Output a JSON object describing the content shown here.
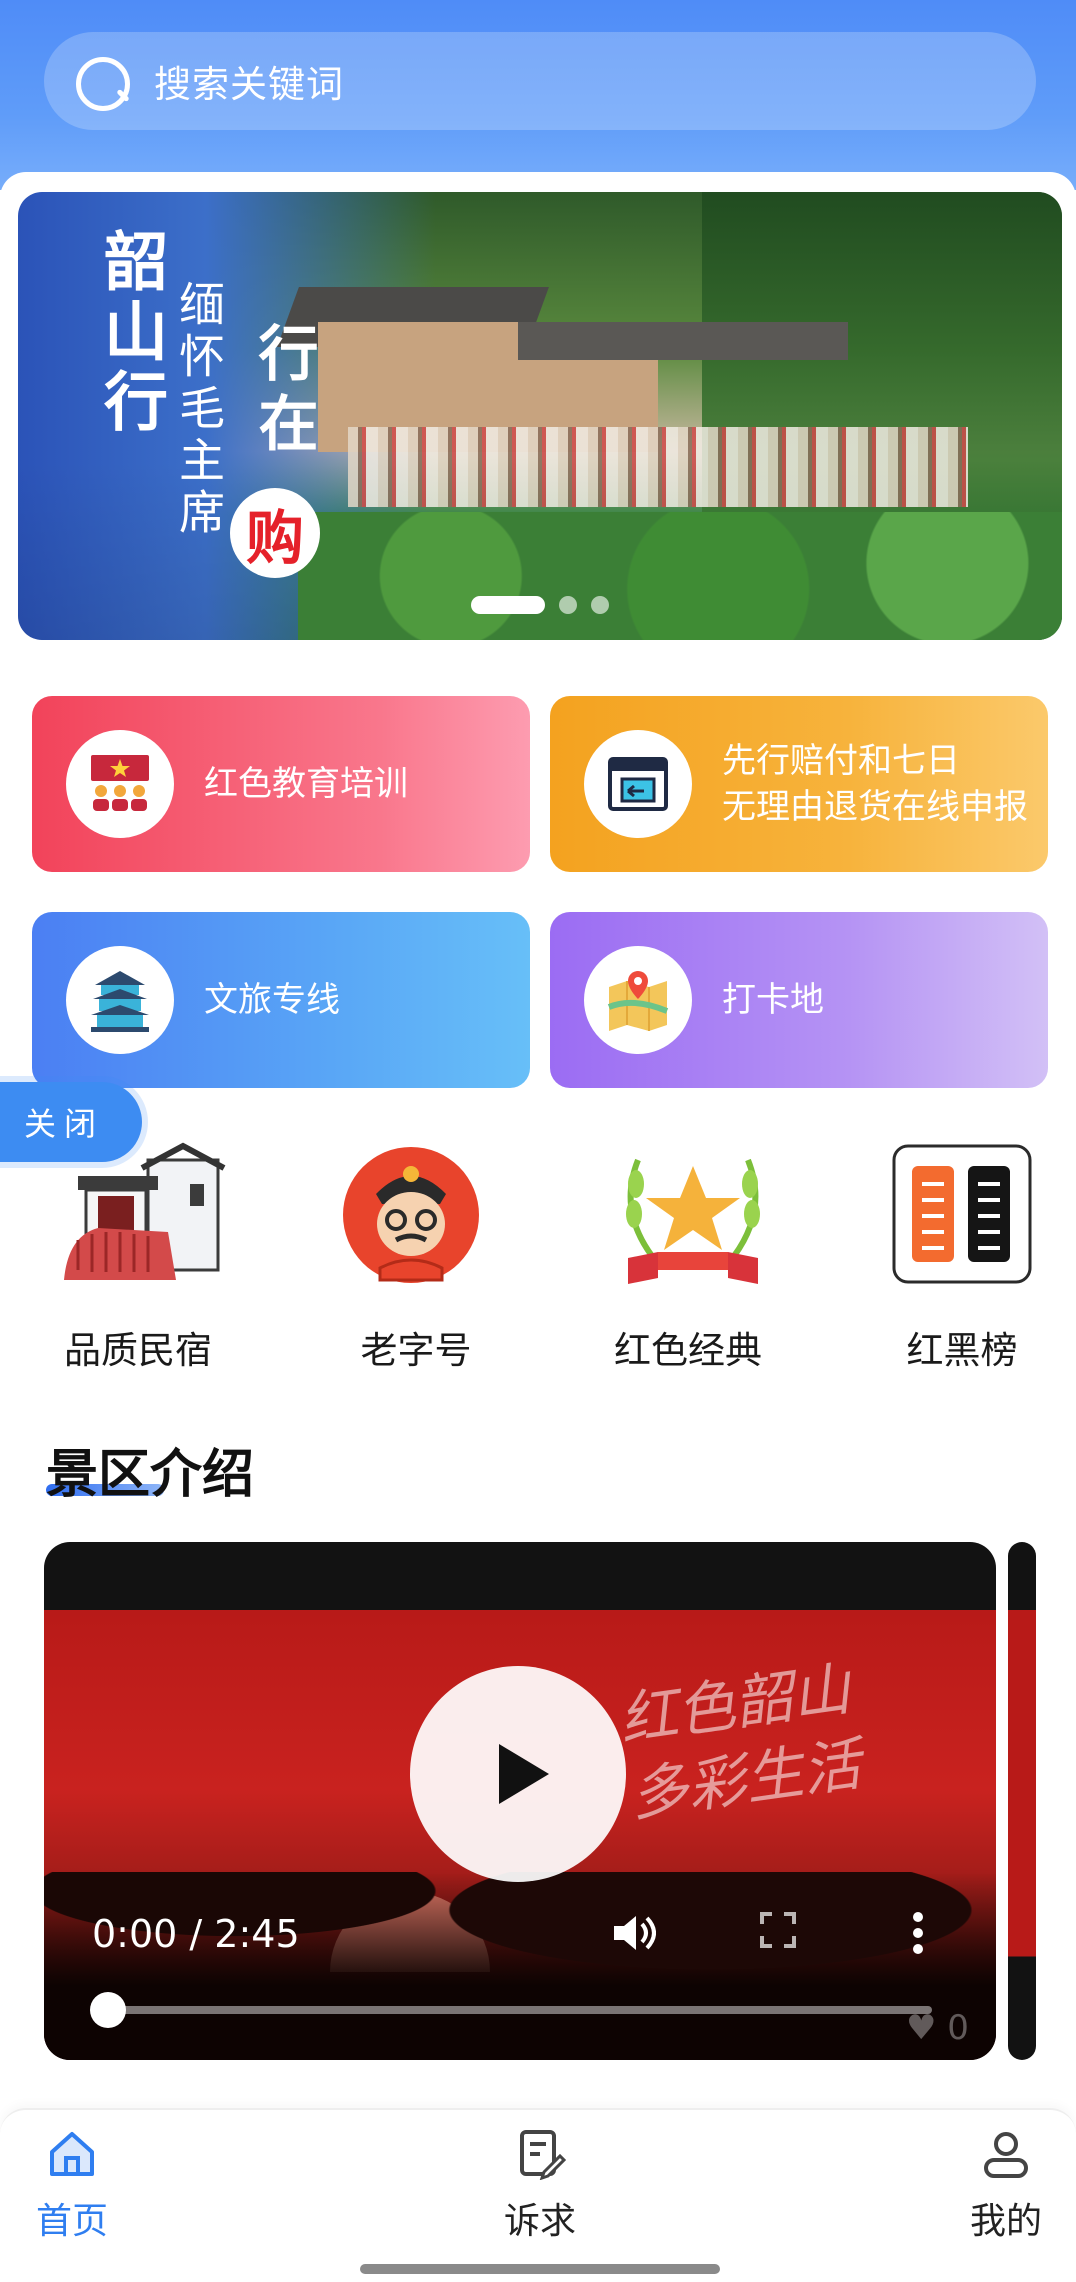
{
  "search": {
    "placeholder": "搜索关键词"
  },
  "banner": {
    "title": "韶山行",
    "subtitle": "缅怀毛主席",
    "slogan": "行在",
    "highlight": "购",
    "active_slide": 1,
    "total_slides": 3
  },
  "features": [
    {
      "label": "红色教育培训",
      "icon": "flag-meeting-icon"
    },
    {
      "label_line1": "先行赔付和七日",
      "label_line2": "无理由退货在线申报",
      "icon": "return-box-icon"
    },
    {
      "label": "文旅专线",
      "icon": "pagoda-icon"
    },
    {
      "label": "打卡地",
      "icon": "map-pin-icon"
    }
  ],
  "close_tag": "关闭",
  "categories": [
    {
      "name": "品质民宿",
      "icon": "house-icon"
    },
    {
      "name": "老字号",
      "icon": "old-shop-mascot-icon"
    },
    {
      "name": "红色经典",
      "icon": "star-trophy-icon"
    },
    {
      "name": "红黑榜",
      "icon": "red-black-list-icon"
    }
  ],
  "section": {
    "title": "景区介绍"
  },
  "video": {
    "time": "0:00 / 2:45",
    "caption_line1": "红色韶山",
    "caption_line2": "多彩生活",
    "likes": "0",
    "progress": 0
  },
  "tabbar": [
    {
      "label": "首页",
      "active": true
    },
    {
      "label": "诉求",
      "active": false
    },
    {
      "label": "我的",
      "active": false
    }
  ],
  "colors": {
    "header": "#4f8cf7",
    "accent": "#2f7ef0",
    "card_red": "#f2435a",
    "card_orange": "#f4a21f",
    "card_blue": "#4b7ff3",
    "card_purple": "#9b6cf3"
  }
}
